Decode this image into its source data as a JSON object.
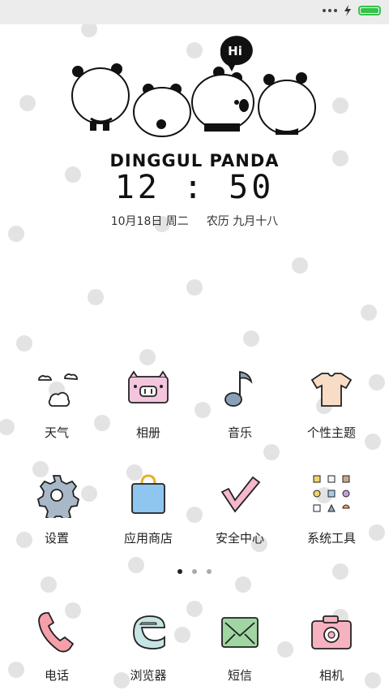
{
  "status_bar": {
    "battery_color": "#35c24a"
  },
  "lockscreen": {
    "speech_bubble": "Hi",
    "brand": "DINGGUL PANDA",
    "time": "12 : 50",
    "date": "10月18日 周二",
    "lunar": "农历 九月十八"
  },
  "apps_row1": [
    {
      "label": "天气",
      "icon": "weather-cloud-icon"
    },
    {
      "label": "相册",
      "icon": "pig-photo-icon"
    },
    {
      "label": "音乐",
      "icon": "music-note-icon"
    },
    {
      "label": "个性主题",
      "icon": "tshirt-icon"
    }
  ],
  "apps_row2": [
    {
      "label": "设置",
      "icon": "gear-icon"
    },
    {
      "label": "应用商店",
      "icon": "shopping-bag-icon"
    },
    {
      "label": "安全中心",
      "icon": "checkmark-icon"
    },
    {
      "label": "系统工具",
      "icon": "tools-grid-icon"
    }
  ],
  "page_indicator": {
    "pages": 3,
    "active": 1
  },
  "dock": [
    {
      "label": "电话",
      "icon": "phone-icon"
    },
    {
      "label": "浏览器",
      "icon": "browser-e-icon"
    },
    {
      "label": "短信",
      "icon": "envelope-icon"
    },
    {
      "label": "相机",
      "icon": "camera-icon"
    }
  ],
  "colors": {
    "background_dots": "#dcdcdc",
    "pig_pink": "#f4c6de",
    "music_blue": "#8a9fb8",
    "shirt_peach": "#f8dcc6",
    "gear_gray": "#a9b8c8",
    "bag_blue": "#8ec6f0",
    "check_pink": "#f5b8cc",
    "phone_pink": "#f59fa8",
    "browser_teal": "#c6e4e4",
    "sms_green": "#9fd6a2",
    "camera_pink": "#f7b2c0"
  }
}
